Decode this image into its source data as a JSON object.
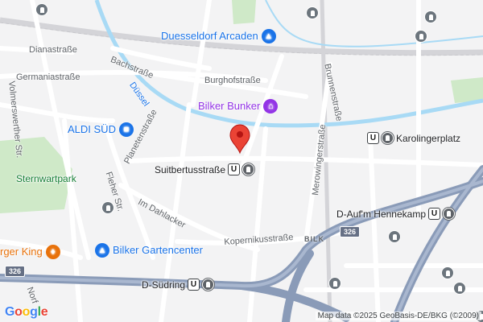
{
  "map": {
    "streets": {
      "dianastrasse": "Dianastraße",
      "bachstrasse": "Bachstraße",
      "germaniastrasse": "Germaniastraße",
      "burghofstrasse": "Burghofstraße",
      "brunnenstrasse": "Brunnenstraße",
      "duessel": "Düssel",
      "volmerswerther": "Volmerswerther Str.",
      "planetenstrasse": "Planetenstraße",
      "merowingerstrasse": "Merowingerstraße",
      "fleher": "Fleher Str.",
      "im_dahlacker": "Im Dahlacker",
      "kopernikusstrasse": "Kopernikusstraße",
      "norf": "Norf"
    },
    "district": "BILK",
    "park": "Sternwartpark",
    "pois": {
      "arcaden": "Duesseldorf Arcaden",
      "bunker": "Bilker Bunker",
      "aldi": "ALDI SÜD",
      "gartencenter": "Bilker Gartencenter",
      "burger_king": "rger King"
    },
    "stations": {
      "karolingerplatz": "Karolingerplatz",
      "suitbertus": "Suitbertusstraße",
      "hennekamp": "D-Auf'm Hennekamp",
      "suedring": "D-Südring"
    },
    "shields": {
      "a": "326",
      "b": "326"
    },
    "attribution": "Map data ©2025 GeoBasis-DE/BKG (©2009)",
    "logo": [
      "G",
      "o",
      "o",
      "g",
      "l",
      "e"
    ],
    "colors": {
      "background": "#f3f3f4",
      "road": "#ffffff",
      "highway": "#8a9bb8",
      "water": "#a8daf5",
      "park": "#cfe9c8",
      "pin": "#ea4335"
    }
  }
}
